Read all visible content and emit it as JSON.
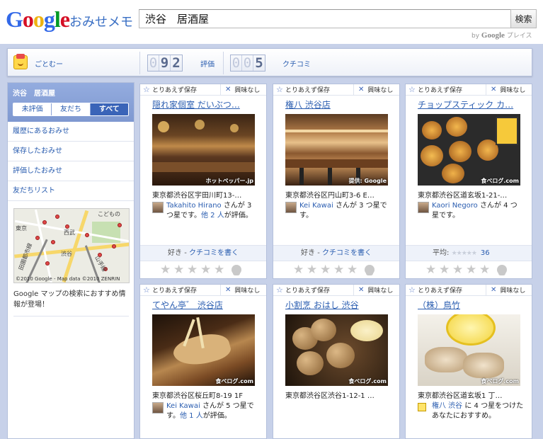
{
  "header": {
    "logo": {
      "g": "G",
      "o1": "o",
      "o2": "o",
      "g2": "g",
      "l": "l",
      "e": "e"
    },
    "product_name": "おみせメモ",
    "search_value": "渋谷　居酒屋",
    "search_button": "検索",
    "by_prefix": "by",
    "by_google": "Google",
    "by_suffix": "プレイス"
  },
  "toolbar": {
    "user_name": "ごとむー",
    "ratings_digits": [
      "0",
      "9",
      "2"
    ],
    "ratings_label": "評価",
    "reviews_digits": [
      "0",
      "0",
      "5"
    ],
    "reviews_label": "クチコミ"
  },
  "sidebar": {
    "title": "渋谷　居酒屋",
    "filters": [
      "未評価",
      "友だち",
      "すべて"
    ],
    "active_filter": "すべて",
    "links": [
      "履歴にあるおみせ",
      "保存したおみせ",
      "評価したおみせ",
      "友だちリスト"
    ],
    "map": {
      "labels": [
        "東京",
        "西武",
        "こどもの",
        "渋谷",
        "山手線",
        "田園都市線"
      ],
      "footer": "©2010 Google - Map data ©2010 ZENRIN"
    },
    "map_description": "Google マップの検索におすすめ情報が登場！"
  },
  "card_actions": {
    "save": "とりあえず保存",
    "dismiss": "興味なし"
  },
  "cards": [
    {
      "title": "隠れ家個室 だいぶつ…",
      "photo_credit": "ホットペッパー.jp",
      "address": "東京都渋谷区宇田川町13-…",
      "reviewer": "Takahito Hirano",
      "review_pre": " さんが 3 つ星です。",
      "friends": "他 2 人",
      "review_post": "が評価。",
      "like_label": "好き - ",
      "write_review": "クチコミを書く"
    },
    {
      "title": "権八 渋谷店",
      "photo_credit": "提供: Google",
      "address": "東京都渋谷区円山町3-6 E…",
      "reviewer": "Kei Kawai",
      "review_pre": " さんが 3 つ星です。",
      "friends": "",
      "review_post": "",
      "like_label": "好き - ",
      "write_review": "クチコミを書く"
    },
    {
      "title": "チョップスティック カ…",
      "photo_credit": "食べログ.com",
      "address": "東京都渋谷区道玄坂1-21-…",
      "reviewer": "Kaori Negoro",
      "review_pre": " さんが 4 つ星です。",
      "friends": "",
      "review_post": "",
      "avg_label": "平均: ",
      "avg_count": "36"
    },
    {
      "title": "てやん亭゛ 渋谷店",
      "photo_credit": "食べログ.com",
      "address": "東京都渋谷区桜丘町8-19 1F",
      "reviewer": "Kei Kawai",
      "review_pre": " さんが 5 つ星です。",
      "friends": "他 1 人",
      "review_post": "が評価。"
    },
    {
      "title": "小割烹 おはし 渋谷",
      "photo_credit": "食べログ.com",
      "address": "東京都渋谷区渋谷1-12-1 …",
      "reviewer": "",
      "review_pre": "",
      "friends": "",
      "review_post": ""
    },
    {
      "title": "（株）鳥竹",
      "photo_credit": "食べログ.com",
      "address": "東京都渋谷区道玄坂1 丁…",
      "reviewer": "権八 渋谷",
      "review_pre": " に 4 つ星をつけたあなたにおすすめ。",
      "friends": "",
      "review_post": ""
    }
  ],
  "colors": {
    "accent": "#2a5db0",
    "panel_blue": "#c7d1e9",
    "sidebar_head": "#8aa3d8"
  }
}
